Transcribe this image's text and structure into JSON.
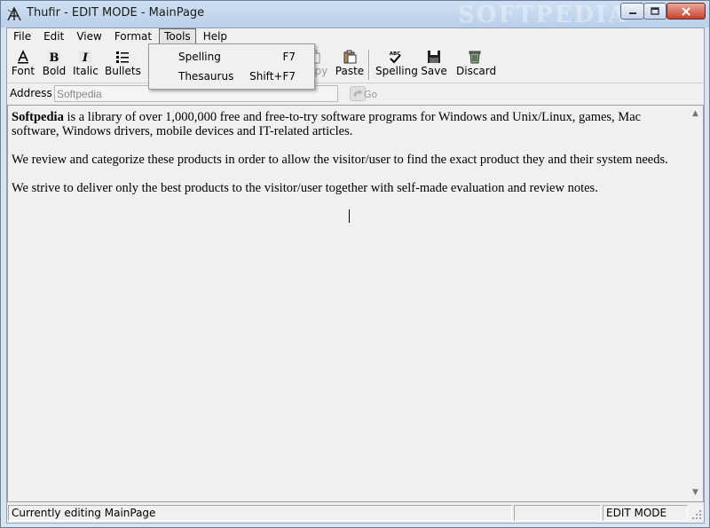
{
  "window": {
    "title": "Thufir - EDIT MODE -  MainPage",
    "watermark": "SOFTPEDIA"
  },
  "menubar": {
    "items": [
      "File",
      "Edit",
      "View",
      "Format",
      "Tools",
      "Help"
    ],
    "active": "Tools"
  },
  "toolbar": {
    "font": "Font",
    "bold": "Bold",
    "italic": "Italic",
    "bullets": "Bullets",
    "copy": "Copy",
    "paste": "Paste",
    "spelling": "Spelling",
    "save": "Save",
    "discard": "Discard"
  },
  "address": {
    "label": "Address",
    "value": "Softpedia",
    "go_label": "Go"
  },
  "tools_menu": {
    "items": [
      {
        "label": "Spelling",
        "shortcut": "F7"
      },
      {
        "label": "Thesaurus",
        "shortcut": "Shift+F7"
      }
    ]
  },
  "document": {
    "p1_bold": "Softpedia",
    "p1_rest": " is a library of over 1,000,000 free and free-to-try software programs for Windows and Unix/Linux, games, Mac software, Windows drivers, mobile devices and IT-related articles.",
    "p2": "We review and categorize these products in order to allow the visitor/user to find the exact product they and their system needs.",
    "p3": "We strive to deliver only the best products to the visitor/user together with self-made evaluation and review notes."
  },
  "statusbar": {
    "message": "Currently editing MainPage",
    "middle": "",
    "mode": "EDIT MODE"
  },
  "colors": {
    "title_gradient_top": "#cfe0f3",
    "close_button": "#c9412b",
    "client_bg": "#f0f0f0"
  },
  "icons": [
    "app-icon",
    "minimize-icon",
    "maximize-icon",
    "close-icon",
    "font-icon",
    "bold-icon",
    "italic-icon",
    "bullets-icon",
    "copy-icon",
    "paste-icon",
    "spelling-icon",
    "save-icon",
    "discard-icon",
    "go-arrow-icon"
  ]
}
